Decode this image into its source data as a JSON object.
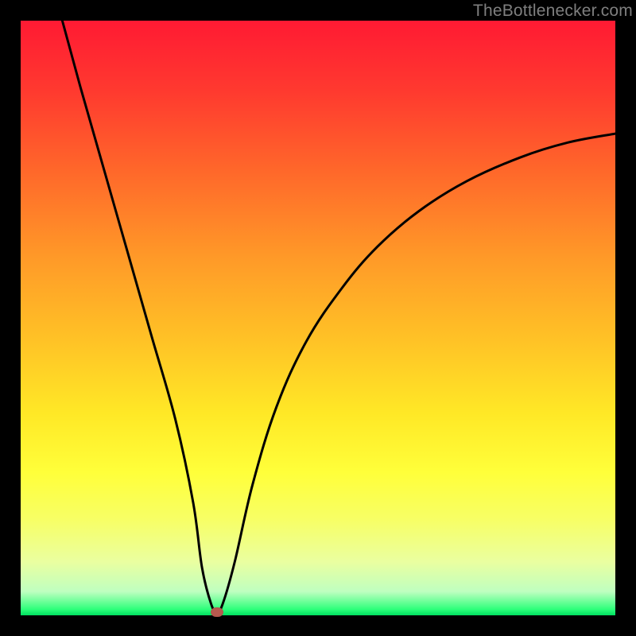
{
  "watermark": "TheBottlenecker.com",
  "colors": {
    "curve": "#000000",
    "marker": "#b75a4f",
    "frame": "#000000"
  },
  "chart_data": {
    "type": "line",
    "title": "",
    "xlabel": "",
    "ylabel": "",
    "xlim": [
      0,
      100
    ],
    "ylim": [
      0,
      100
    ],
    "series": [
      {
        "name": "bottleneck-curve",
        "x": [
          7,
          10,
          14,
          18,
          22,
          26,
          29,
          30.5,
          32,
          33,
          34,
          36,
          39,
          43,
          48,
          54,
          60,
          67,
          75,
          84,
          92,
          100
        ],
        "y": [
          100,
          89,
          75,
          61,
          47,
          33,
          19,
          8,
          2,
          0.5,
          2,
          9,
          22,
          35,
          46,
          55,
          62,
          68,
          73,
          77,
          79.5,
          81
        ]
      }
    ],
    "marker": {
      "x": 33,
      "y": 0.5
    },
    "grid": false,
    "legend": false
  }
}
